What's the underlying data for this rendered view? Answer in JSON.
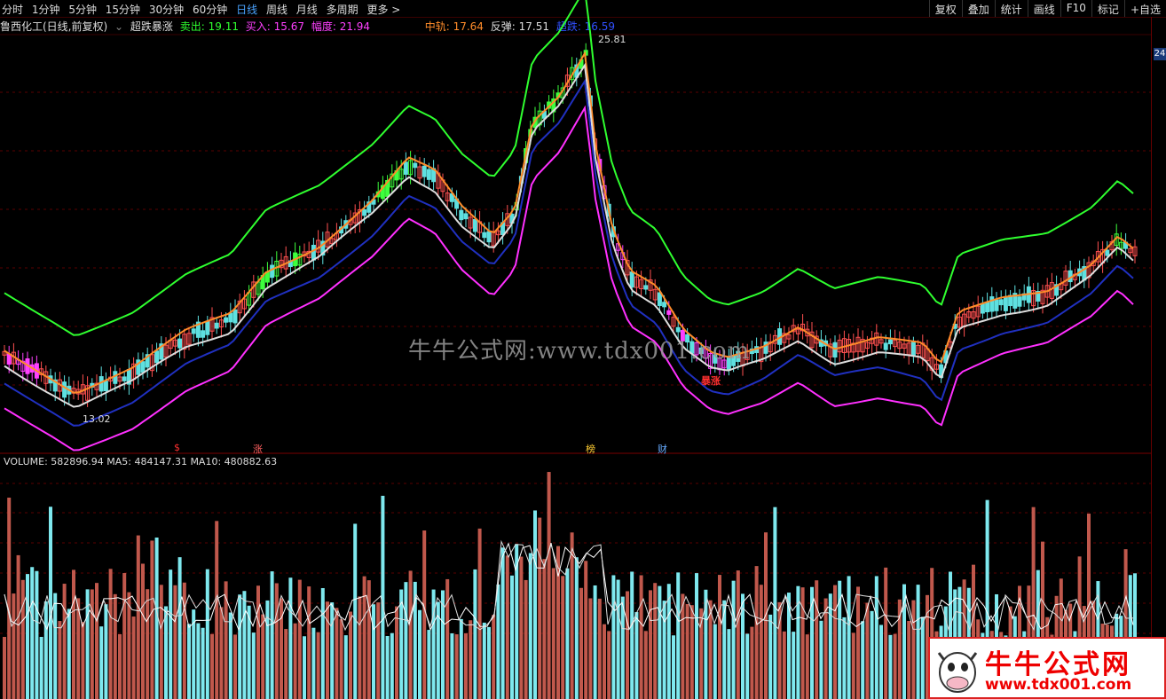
{
  "menu": {
    "items": [
      "分时",
      "1分钟",
      "5分钟",
      "15分钟",
      "30分钟",
      "60分钟",
      "日线",
      "周线",
      "月线",
      "多周期",
      "更多 >"
    ],
    "active_index": 6
  },
  "tools": [
    "复权",
    "叠加",
    "统计",
    "画线",
    "F10",
    "标记",
    "+自选"
  ],
  "title": {
    "stock": "鲁西化工(日线,前复权)",
    "indicator": "超跌暴涨",
    "sell_label": "卖出: 19.11",
    "buy_label": "买入: 15.67",
    "range_label": "幅度: 21.94",
    "mid_label": "中轨: 17.64",
    "rebound_label": "反弹: 17.51",
    "oversold_label": "超跌: 16.59",
    "colors": {
      "sell": "#2fff2f",
      "buy": "#ff40ff",
      "range": "#ff40ff",
      "mid": "#ff8c2a",
      "rebound": "#dddddd",
      "oversold": "#3050ff"
    }
  },
  "price_axis_badge": "24",
  "annotations": {
    "high": "25.81",
    "low": "13.02",
    "signal": "暴涨",
    "marker_zhang": "涨",
    "marker_bang": "榜",
    "marker_cai": "财",
    "marker_s": "$"
  },
  "volume_title": "VOLUME: 582896.94  MA5: 484147.31  MA10: 480882.63",
  "watermark": "牛牛公式网:www.tdx001.com",
  "logo": {
    "cn": "牛牛公式网",
    "url": "www.tdx001.com"
  }
}
